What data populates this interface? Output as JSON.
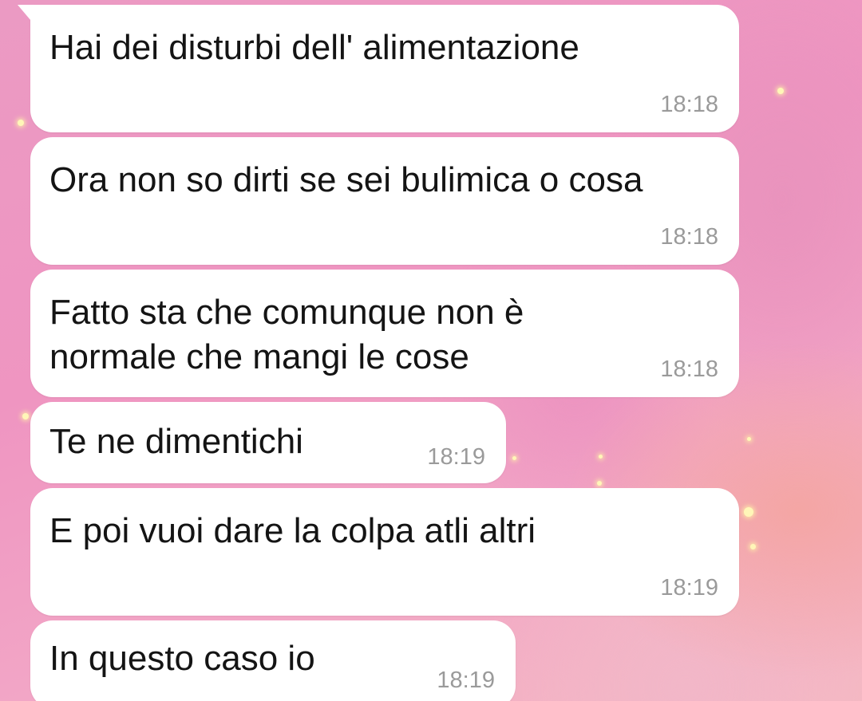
{
  "messages": [
    {
      "text": "Hai dei disturbi dell' alimentazione",
      "time": "18:18"
    },
    {
      "text": "Ora non so dirti se sei bulimica o cosa",
      "time": "18:18"
    },
    {
      "text": "Fatto sta che comunque non è\nnormale che mangi le cose",
      "time": "18:18"
    },
    {
      "text": "Te ne dimentichi",
      "time": "18:19"
    },
    {
      "text": "E poi vuoi dare la colpa atli altri",
      "time": "18:19"
    },
    {
      "text": "In questo caso io",
      "time": "18:19"
    }
  ],
  "colors": {
    "bubble": "#ffffff",
    "text": "#141414",
    "timestamp": "#9a9a9a",
    "background": "#ef95c1"
  }
}
